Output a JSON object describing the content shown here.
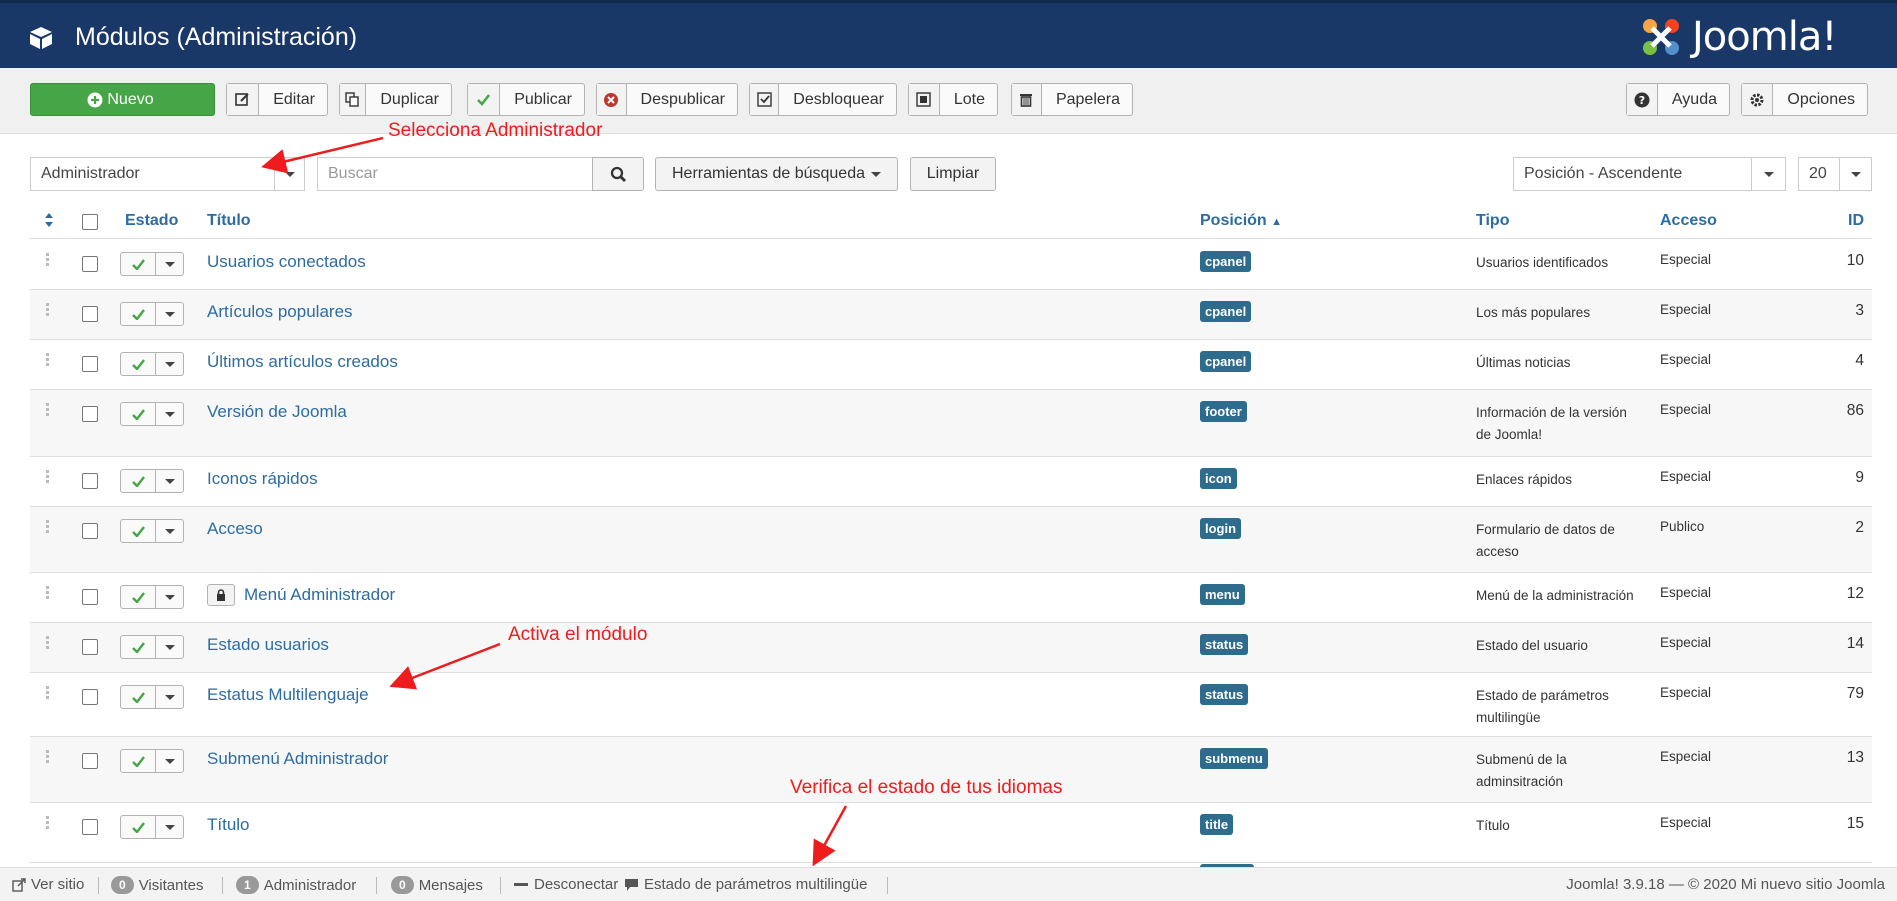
{
  "header": {
    "title": "Módulos (Administración)",
    "logo_text": "Joomla!"
  },
  "toolbar": {
    "new": "Nuevo",
    "edit": "Editar",
    "duplicate": "Duplicar",
    "publish": "Publicar",
    "unpublish": "Despublicar",
    "unlock": "Desbloquear",
    "batch": "Lote",
    "trash": "Papelera",
    "help": "Ayuda",
    "options": "Opciones"
  },
  "filters": {
    "client": "Administrador",
    "search_placeholder": "Buscar",
    "search_tools": "Herramientas de búsqueda",
    "clear": "Limpiar",
    "ordering": "Posición - Ascendente",
    "limit": "20"
  },
  "annotations": {
    "select_admin": "Selecciona Administrador",
    "activate": "Activa el módulo",
    "verify": "Verifica el estado de tus idiomas"
  },
  "columns": {
    "status": "Estado",
    "title": "Título",
    "position": "Posición",
    "type": "Tipo",
    "access": "Acceso",
    "id": "ID"
  },
  "rows": [
    {
      "title": "Usuarios conectados",
      "position": "cpanel",
      "type": "Usuarios identificados",
      "access": "Especial",
      "id": "10"
    },
    {
      "title": "Artículos populares",
      "position": "cpanel",
      "type": "Los más populares",
      "access": "Especial",
      "id": "3"
    },
    {
      "title": "Últimos artículos creados",
      "position": "cpanel",
      "type": "Últimas noticias",
      "access": "Especial",
      "id": "4"
    },
    {
      "title": "Versión de Joomla",
      "position": "footer",
      "type": "Información de la versión de Joomla!",
      "access": "Especial",
      "id": "86"
    },
    {
      "title": "Iconos rápidos",
      "position": "icon",
      "type": "Enlaces rápidos",
      "access": "Especial",
      "id": "9"
    },
    {
      "title": "Acceso",
      "position": "login",
      "type": "Formulario de datos de acceso",
      "access": "Publico",
      "id": "2"
    },
    {
      "title": "Menú Administrador",
      "position": "menu",
      "type": "Menú de la administración",
      "access": "Especial",
      "id": "12"
    },
    {
      "title": "Estado usuarios",
      "position": "status",
      "type": "Estado del usuario",
      "access": "Especial",
      "id": "14"
    },
    {
      "title": "Estatus Multilenguaje",
      "position": "status",
      "type": "Estado de parámetros multilingüe",
      "access": "Especial",
      "id": "79"
    },
    {
      "title": "Submenú Administrador",
      "position": "submenu",
      "type": "Submenú de la adminsitración",
      "access": "Especial",
      "id": "13"
    },
    {
      "title": "Título",
      "position": "title",
      "type": "Título",
      "access": "Especial",
      "id": "15"
    }
  ],
  "footer": {
    "view_site": "Ver sitio",
    "visitors_count": "0",
    "visitors": "Visitantes",
    "admins_count": "1",
    "admins": "Administrador",
    "messages_count": "0",
    "messages": "Mensajes",
    "logout": "Desconectar",
    "multilang": "Estado de parámetros multilingüe",
    "version": "Joomla! 3.9.18",
    "copyright": "— © 2020 Mi nuevo sitio Joomla"
  }
}
